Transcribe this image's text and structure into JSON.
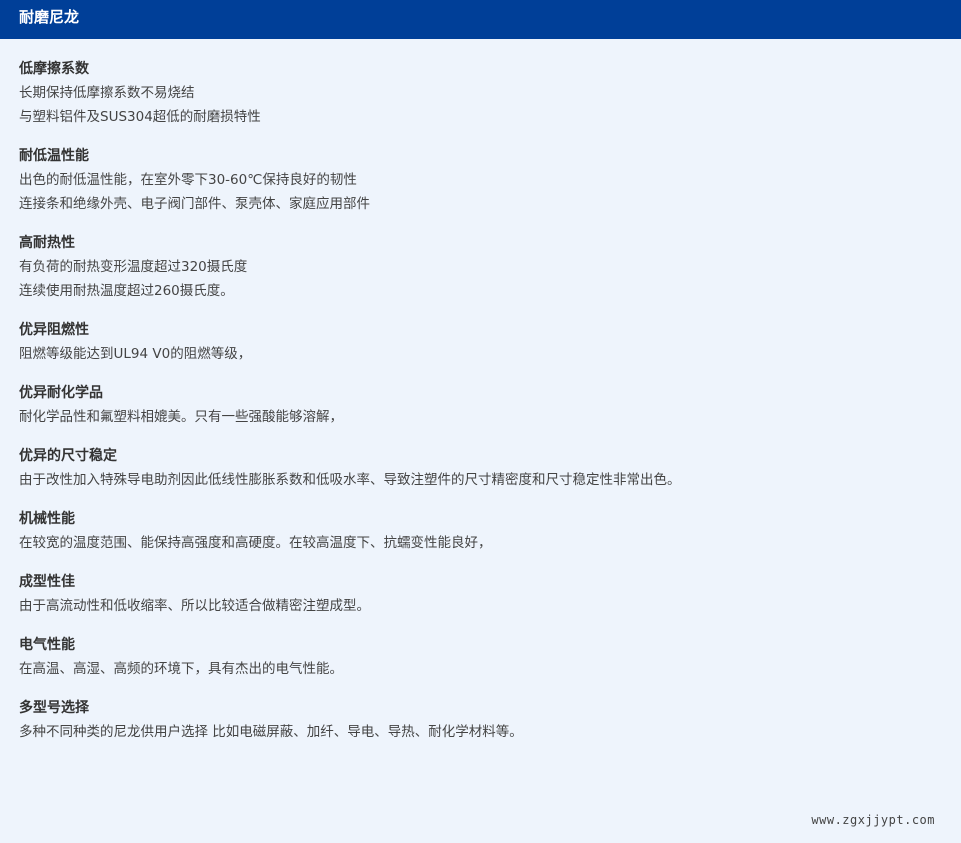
{
  "header": {
    "title": "耐磨尼龙"
  },
  "sections": [
    {
      "title": "低摩擦系数",
      "lines": [
        "长期保持低摩擦系数不易烧结",
        "与塑料铝件及SUS304超低的耐磨损特性"
      ]
    },
    {
      "title": "耐低温性能",
      "lines": [
        "出色的耐低温性能，在室外零下30-60℃保持良好的韧性",
        "连接条和绝缘外壳、电子阀门部件、泵壳体、家庭应用部件"
      ]
    },
    {
      "title": "高耐热性",
      "lines": [
        "有负荷的耐热变形温度超过320摄氏度",
        "连续使用耐热温度超过260摄氏度。"
      ]
    },
    {
      "title": "优异阻燃性",
      "lines": [
        "阻燃等级能达到UL94 V0的阻燃等级，"
      ]
    },
    {
      "title": "优异耐化学品",
      "lines": [
        "耐化学品性和氟塑料相媲美。只有一些强酸能够溶解，"
      ]
    },
    {
      "title": "优异的尺寸稳定",
      "lines": [
        "由于改性加入特殊导电助剂因此低线性膨胀系数和低吸水率、导致注塑件的尺寸精密度和尺寸稳定性非常出色。"
      ]
    },
    {
      "title": "机械性能",
      "lines": [
        "在较宽的温度范围、能保持高强度和高硬度。在较高温度下、抗蠕变性能良好，"
      ]
    },
    {
      "title": "成型性佳",
      "lines": [
        "由于高流动性和低收缩率、所以比较适合做精密注塑成型。"
      ]
    },
    {
      "title": "电气性能",
      "lines": [
        "在高温、高湿、高频的环境下，具有杰出的电气性能。"
      ]
    },
    {
      "title": "多型号选择",
      "lines": [
        "多种不同种类的尼龙供用户选择 比如电磁屏蔽、加纤、导电、导热、耐化学材料等。"
      ]
    }
  ],
  "watermark": "www.zgxjjypt.com",
  "colors": {
    "header_bg": "#003f98",
    "page_bg": "#eef4fc"
  }
}
